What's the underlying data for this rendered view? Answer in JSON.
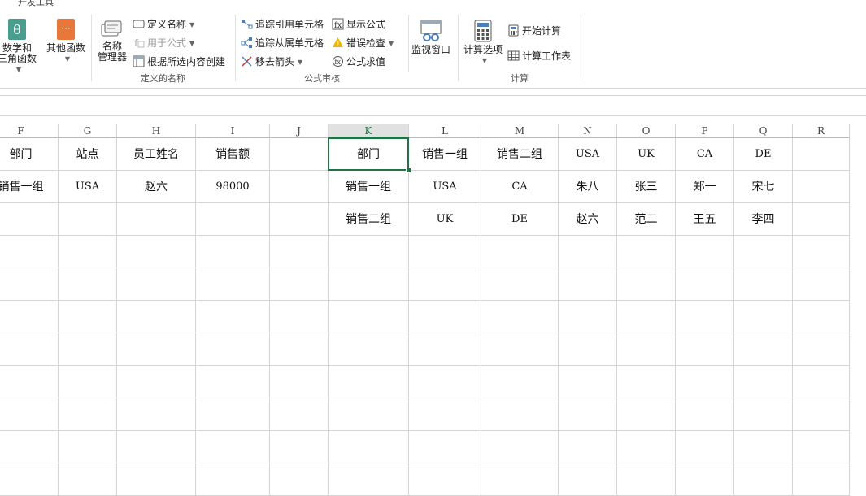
{
  "ribbon": {
    "tab_label": "开发工具",
    "func_lib": {
      "math_line1": "数学和",
      "math_line2": "三角函数",
      "other_label": "其他函数"
    },
    "names": {
      "manager_line1": "名称",
      "manager_line2": "管理器",
      "define_name": "定义名称",
      "use_in_formula": "用于公式",
      "create_from_selection": "根据所选内容创建",
      "group_label": "定义的名称"
    },
    "audit": {
      "trace_precedents": "追踪引用单元格",
      "trace_dependents": "追踪从属单元格",
      "remove_arrows": "移去箭头",
      "show_formulas": "显示公式",
      "error_check": "错误检查",
      "evaluate_formula": "公式求值",
      "watch_window": "监视窗口",
      "group_label": "公式审核"
    },
    "calc": {
      "options": "计算选项",
      "calc_now": "开始计算",
      "calc_sheet": "计算工作表",
      "group_label": "计算"
    }
  },
  "columns": [
    "F",
    "G",
    "H",
    "I",
    "J",
    "K",
    "L",
    "M",
    "N",
    "O",
    "P",
    "Q",
    "R"
  ],
  "active_column": "K",
  "rows": [
    [
      "部门",
      "站点",
      "员工姓名",
      "销售额",
      "",
      "部门",
      "销售一组",
      "销售二组",
      "USA",
      "UK",
      "CA",
      "DE",
      ""
    ],
    [
      "销售一组",
      "USA",
      "赵六",
      "98000",
      "",
      "销售一组",
      "USA",
      "CA",
      "朱八",
      "张三",
      "郑一",
      "宋七",
      ""
    ],
    [
      "",
      "",
      "",
      "",
      "",
      "销售二组",
      "UK",
      "DE",
      "赵六",
      "范二",
      "王五",
      "李四",
      ""
    ],
    [
      "",
      "",
      "",
      "",
      "",
      "",
      "",
      "",
      "",
      "",
      "",
      "",
      ""
    ],
    [
      "",
      "",
      "",
      "",
      "",
      "",
      "",
      "",
      "",
      "",
      "",
      "",
      ""
    ],
    [
      "",
      "",
      "",
      "",
      "",
      "",
      "",
      "",
      "",
      "",
      "",
      "",
      ""
    ],
    [
      "",
      "",
      "",
      "",
      "",
      "",
      "",
      "",
      "",
      "",
      "",
      "",
      ""
    ],
    [
      "",
      "",
      "",
      "",
      "",
      "",
      "",
      "",
      "",
      "",
      "",
      "",
      ""
    ],
    [
      "",
      "",
      "",
      "",
      "",
      "",
      "",
      "",
      "",
      "",
      "",
      "",
      ""
    ],
    [
      "",
      "",
      "",
      "",
      "",
      "",
      "",
      "",
      "",
      "",
      "",
      "",
      ""
    ],
    [
      "",
      "",
      "",
      "",
      "",
      "",
      "",
      "",
      "",
      "",
      "",
      "",
      ""
    ]
  ],
  "selected_cell": "K1",
  "colors": {
    "accent": "#217346",
    "gridline": "#d4d4d4",
    "active_header_bg": "#e1e1e1"
  }
}
